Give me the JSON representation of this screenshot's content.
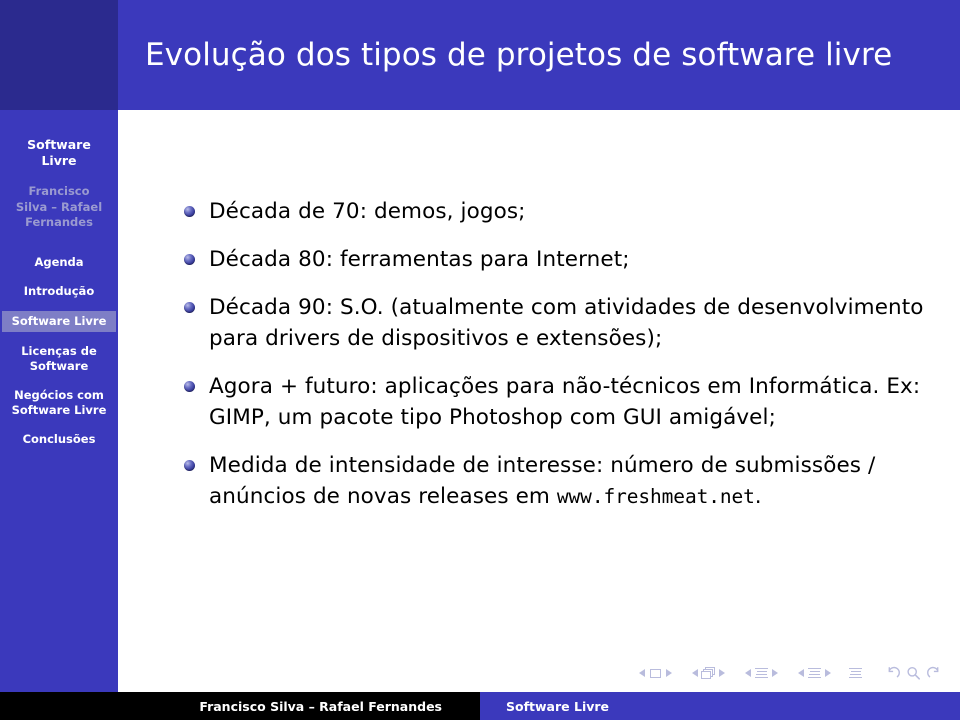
{
  "header": {
    "title": "Evolução dos tipos de projetos de software livre"
  },
  "sidebar": {
    "title_line1": "Software",
    "title_line2": "Livre",
    "authors_line1": "Francisco",
    "authors_line2": "Silva – Rafael",
    "authors_line3": "Fernandes",
    "items": [
      {
        "label": "Agenda",
        "active": false
      },
      {
        "label": "Introdução",
        "active": false
      },
      {
        "label": "Software Livre",
        "active": true
      },
      {
        "label": "Licenças de Software",
        "active": false
      },
      {
        "label": "Negócios com Software Livre",
        "active": false
      },
      {
        "label": "Conclusões",
        "active": false
      }
    ]
  },
  "content": {
    "bullets": [
      {
        "text": "Década de 70: demos, jogos;"
      },
      {
        "text": "Década 80: ferramentas para Internet;"
      },
      {
        "text": "Década 90: S.O. (atualmente com atividades de desenvolvimento para drivers de dispositivos e extensões);"
      },
      {
        "text": "Agora + futuro: aplicações para não-técnicos em Informática. Ex: GIMP, um pacote tipo Photoshop com GUI amigável;"
      },
      {
        "text_before": "Medida de intensidade de interesse: número de submissões / anúncios de novas releases em ",
        "mono": "www.freshmeat.net",
        "text_after": "."
      }
    ]
  },
  "navigation": {
    "slide_prev": "◀",
    "slide_next": "▶",
    "frame_prev": "◀",
    "frame_next": "▶",
    "subsection_prev": "◀",
    "subsection_next": "▶",
    "section_prev": "◀",
    "section_next": "▶",
    "back_label": "back",
    "search_label": "search",
    "forward_label": "forward"
  },
  "footer": {
    "authors": "Francisco Silva – Rafael Fernandes",
    "title": "Software Livre"
  },
  "colors": {
    "primary_blue": "#3B39BC",
    "dark_blue": "#2B2A8E",
    "active_item": "#7E7EC6",
    "author_text": "#9A9AD0",
    "nav_symbol": "#B9BCDD",
    "footer_black": "#000000"
  }
}
